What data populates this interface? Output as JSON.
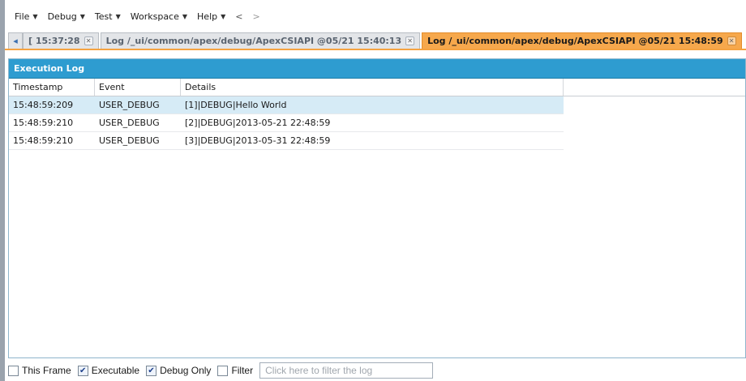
{
  "menu": {
    "items": [
      "File",
      "Debug",
      "Test",
      "Workspace",
      "Help"
    ],
    "back": "<",
    "forward": ">"
  },
  "tabs": [
    {
      "label": "[ 15:37:28",
      "active": false
    },
    {
      "label": "Log /_ui/common/apex/debug/ApexCSIAPI @05/21 15:40:13",
      "active": false
    },
    {
      "label": "Log /_ui/common/apex/debug/ApexCSIAPI @05/21 15:48:59",
      "active": true
    }
  ],
  "panel": {
    "title": "Execution Log",
    "columns": [
      "Timestamp",
      "Event",
      "Details"
    ],
    "rows": [
      {
        "timestamp": "15:48:59:209",
        "event": "USER_DEBUG",
        "details": "[1]|DEBUG|Hello World"
      },
      {
        "timestamp": "15:48:59:210",
        "event": "USER_DEBUG",
        "details": "[2]|DEBUG|2013-05-21 22:48:59"
      },
      {
        "timestamp": "15:48:59:210",
        "event": "USER_DEBUG",
        "details": "[3]|DEBUG|2013-05-31 22:48:59"
      }
    ]
  },
  "bottombar": {
    "this_frame": {
      "label": "This Frame",
      "checked": false
    },
    "executable": {
      "label": "Executable",
      "checked": true
    },
    "debug_only": {
      "label": "Debug Only",
      "checked": true
    },
    "filter": {
      "label": "Filter",
      "checked": false
    },
    "filter_placeholder": "Click here to filter the log"
  },
  "colors": {
    "panel_header": "#2e9cd0",
    "active_tab": "#f6a84c",
    "selected_row": "#d6ebf6"
  }
}
